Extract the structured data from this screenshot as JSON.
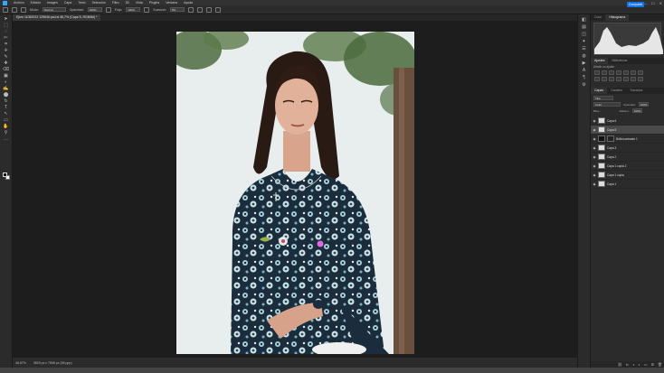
{
  "menu": {
    "items": [
      "Archivo",
      "Edición",
      "Imagen",
      "Capa",
      "Texto",
      "Selección",
      "Filtro",
      "3D",
      "Vista",
      "Plugins",
      "Ventana",
      "Ayuda"
    ]
  },
  "window_controls": [
    "—",
    "☐",
    "✕"
  ],
  "options_bar": {
    "mode_label": "Modo:",
    "mode_value": "Normal",
    "opacity_label": "Opacidad:",
    "opacity_value": "100%",
    "flow_label": "Flujo:",
    "flow_value": "100%",
    "smoothing_label": "Suavizar:",
    "smoothing_value": "0%",
    "share_label": "Compartir"
  },
  "document": {
    "tab_title": "Ejem 11082022 125646.psd al 46,7% (Capa 5, RGB/8#) *"
  },
  "tools": [
    "➤",
    "⬚",
    "◌",
    "✄",
    "⌗",
    "✛",
    "✎",
    "✚",
    "⌫",
    "▣",
    "◐",
    "✍",
    "⬤",
    "↻",
    "T",
    "↖",
    "▭",
    "✋",
    "⚲",
    "…"
  ],
  "status_bar": {
    "zoom": "46,67%",
    "info": "3829 px x 7808 px (96 ppp)"
  },
  "right_icons": [
    "◧",
    "▤",
    "◫",
    "✦",
    "☰",
    "◍",
    "▶",
    "A",
    "¶",
    "⚙"
  ],
  "histogram_panel": {
    "tabs": [
      "Color",
      "Histograma"
    ],
    "active_tab": "Histograma"
  },
  "adjustments_panel": {
    "tabs": [
      "Ajustes",
      "Bibliotecas"
    ],
    "subtitle": "Añadir un ajuste"
  },
  "layers_panel": {
    "tabs": [
      "Capas",
      "Canales",
      "Trazados"
    ],
    "filter_label": "Tipo",
    "blend_mode": "Color",
    "opacity_label": "Opacidad:",
    "opacity_value": "100%",
    "lock_label": "Bloq.:",
    "fill_label": "Relleno:",
    "fill_value": "100%",
    "layers": [
      {
        "name": "Capa 6",
        "thumb": "light",
        "selected": false
      },
      {
        "name": "Capa 5",
        "thumb": "light",
        "selected": true
      },
      {
        "name": "Brillo/contraste 1",
        "thumb": "mask",
        "selected": false
      },
      {
        "name": "Capa 3",
        "thumb": "light",
        "selected": false
      },
      {
        "name": "Capa 2",
        "thumb": "light",
        "selected": false
      },
      {
        "name": "Capa 1 copia 2",
        "thumb": "light",
        "selected": false
      },
      {
        "name": "Capa 1 copia",
        "thumb": "light",
        "selected": false
      },
      {
        "name": "Capa 1",
        "thumb": "light",
        "selected": false
      }
    ],
    "footer_icons": [
      "⛓",
      "fx",
      "◑",
      "◐",
      "▭",
      "⊞",
      "🗑"
    ]
  },
  "colors": {
    "accent": "#1473e6",
    "dress": "#1b2d3d",
    "hair": "#2a1a14",
    "background_wall": "#e9eded"
  }
}
